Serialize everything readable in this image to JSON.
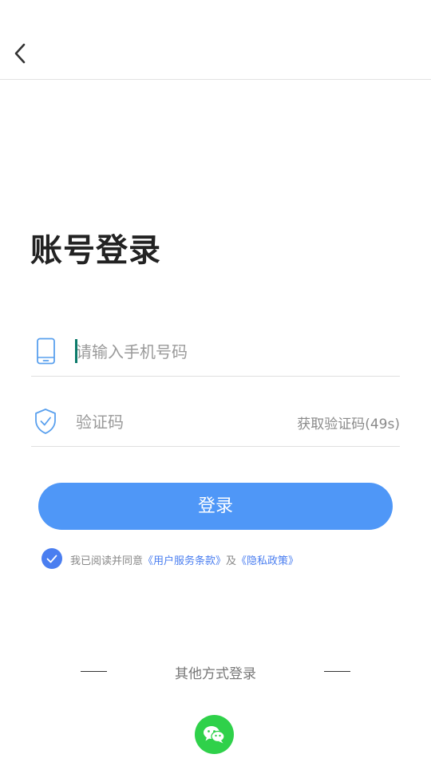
{
  "header": {
    "back_icon": "chevron-left-icon"
  },
  "title": "账号登录",
  "phone": {
    "icon": "phone-icon",
    "placeholder": "请输入手机号码",
    "value": ""
  },
  "code": {
    "icon": "shield-check-icon",
    "placeholder": "验证码",
    "value": "",
    "get_code_label": "获取验证码(49s)"
  },
  "login_button": "登录",
  "agreement": {
    "checked": true,
    "prefix": "我已阅读并同意",
    "terms_link": "《用户服务条款》",
    "and": "及",
    "privacy_link": "《隐私政策》"
  },
  "other_login": {
    "label": "其他方式登录",
    "wechat_icon": "wechat-icon"
  },
  "colors": {
    "primary": "#4f97f7",
    "link": "#4a7ef0",
    "wechat": "#2fd14a",
    "caret": "#0b7a6a"
  }
}
